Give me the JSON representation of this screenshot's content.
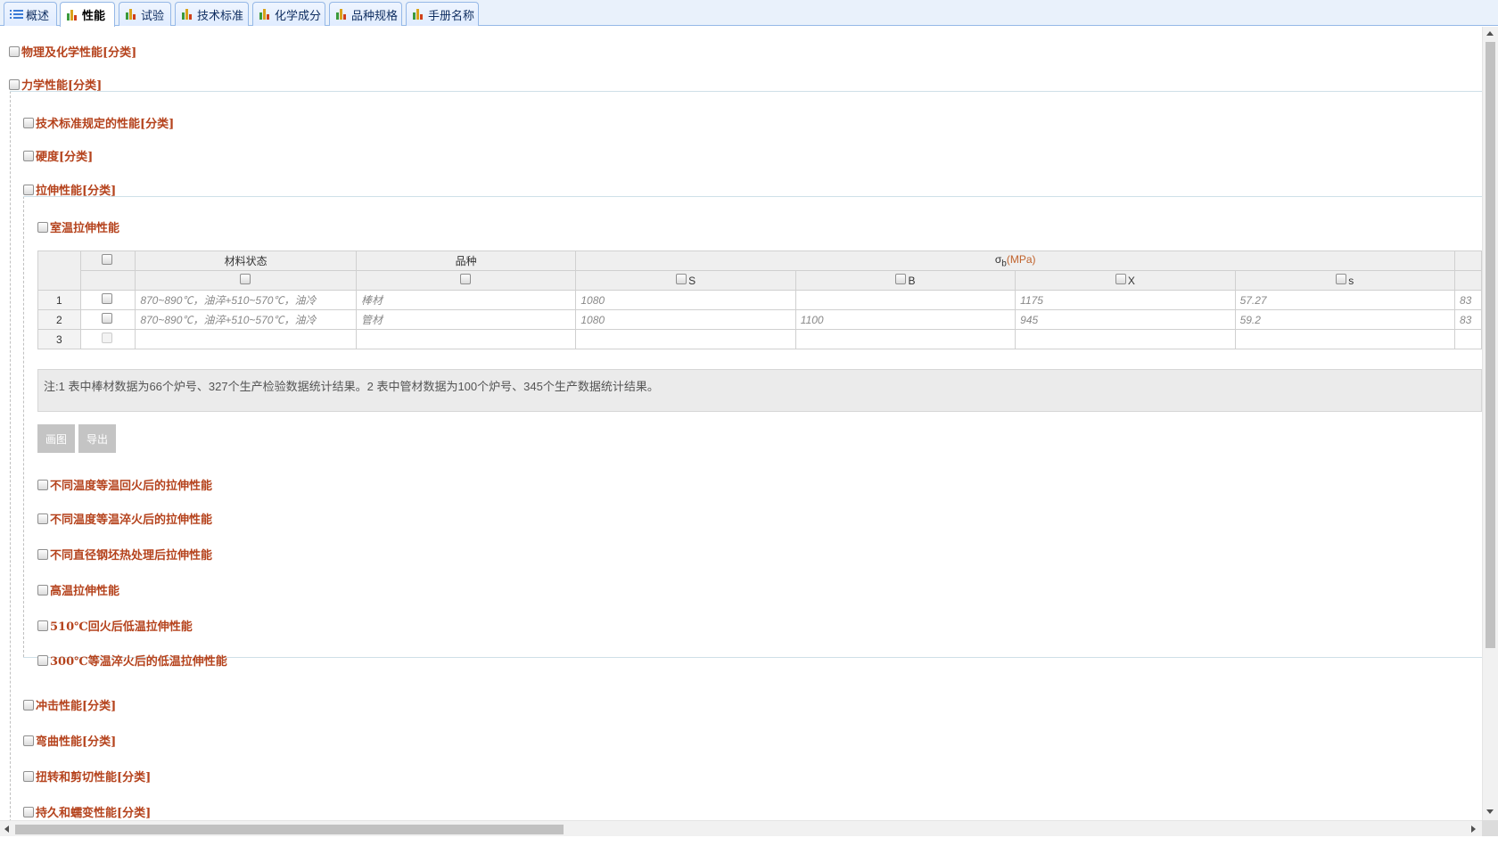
{
  "tabs": [
    {
      "label": "概述",
      "icon": "list-icon"
    },
    {
      "label": "性能",
      "icon": "bar-chart-icon",
      "active": true
    },
    {
      "label": "试验",
      "icon": "bar-chart-icon"
    },
    {
      "label": "技术标准",
      "icon": "bar-chart-icon"
    },
    {
      "label": "化学成分",
      "icon": "bar-chart-icon"
    },
    {
      "label": "品种规格",
      "icon": "bar-chart-icon"
    },
    {
      "label": "手册名称",
      "icon": "bar-chart-icon"
    }
  ],
  "tree": {
    "physical": "物理及化学性能[分类]",
    "mechanical": "力学性能[分类]",
    "tech_std": "技术标准规定的性能[分类]",
    "hardness": "硬度[分类]",
    "tensile": "拉伸性能[分类]",
    "room_temp": "室温拉伸性能",
    "sub_items": [
      "不同温度等温回火后的拉伸性能",
      "不同温度等温淬火后的拉伸性能",
      "不同直径钢坯热处理后拉伸性能",
      "高温拉伸性能",
      "510℃回火后低温拉伸性能",
      "300℃等温淬火后的低温拉伸性能"
    ],
    "impact": "冲击性能[分类]",
    "bending": "弯曲性能[分类]",
    "torsion": "扭转和剪切性能[分类]",
    "fatigue": "持久和蠕变性能[分类]"
  },
  "table": {
    "col_material": "材料状态",
    "col_variety": "品种",
    "col_sigma": "σ",
    "col_sigma_sub": "b",
    "col_sigma_unit": "(MPa)",
    "sub_cols": [
      "S",
      "B",
      "X",
      "s"
    ],
    "rows": [
      {
        "n": "1",
        "material": "870~890℃，油淬+510~570℃，油冷",
        "variety": "棒材",
        "S": "1080",
        "B": "",
        "X": "1175",
        "s": "57.27",
        "next": "83"
      },
      {
        "n": "2",
        "material": "870~890℃，油淬+510~570℃，油冷",
        "variety": "管材",
        "S": "1080",
        "B": "1100",
        "X": "945",
        "s": "59.2",
        "next": "83"
      },
      {
        "n": "3",
        "material": "",
        "variety": "",
        "S": "",
        "B": "",
        "X": "",
        "s": "",
        "next": ""
      }
    ]
  },
  "note": "注:1 表中棒材数据为66个炉号、327个生产检验数据统计结果。2 表中管材数据为100个炉号、345个生产数据统计结果。",
  "buttons": {
    "draw": "画图",
    "export": "导出"
  }
}
